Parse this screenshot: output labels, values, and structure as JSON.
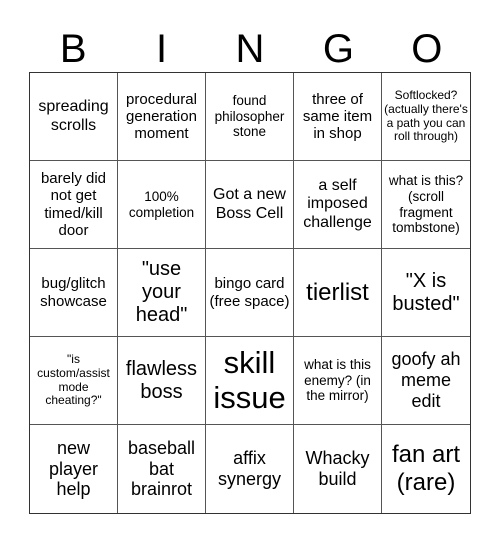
{
  "header": [
    "B",
    "I",
    "N",
    "G",
    "O"
  ],
  "cells": [
    "spreading scrolls",
    "procedural generation moment",
    "found philosopher stone",
    "three of same item in shop",
    "Softlocked? (actually there's a path you can roll through)",
    "barely did not get timed/kill door",
    "100% completion",
    "Got a new Boss Cell",
    "a self imposed challenge",
    "what is this? (scroll fragment tombstone)",
    "bug/glitch showcase",
    "\"use your head\"",
    "bingo card (free space)",
    "tierlist",
    "\"X is busted\"",
    "\"is custom/assist mode cheating?\"",
    "flawless boss",
    "skill issue",
    "what is this enemy? (in the mirror)",
    "goofy ah meme edit",
    "new player help",
    "baseball bat brainrot",
    "affix synergy",
    "Whacky build",
    "fan art (rare)"
  ]
}
